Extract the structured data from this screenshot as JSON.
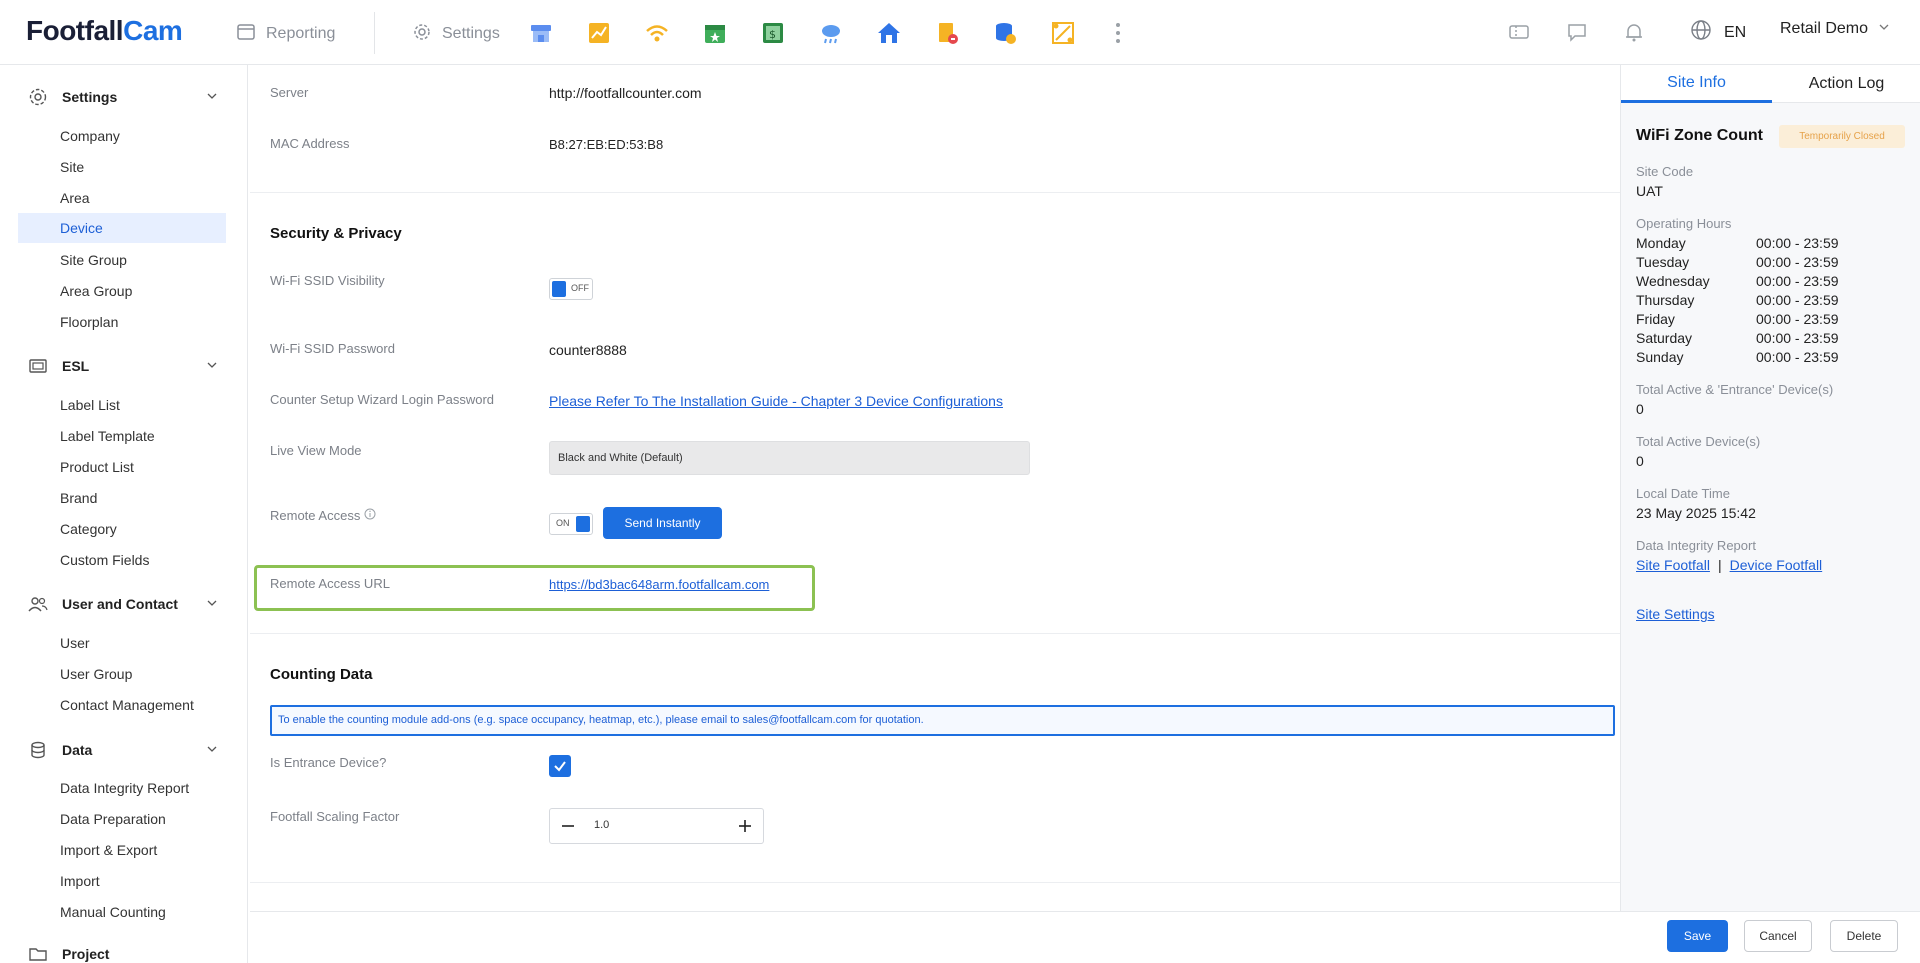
{
  "brand": {
    "part1": "Footfall",
    "part2": "Cam"
  },
  "nav": {
    "reporting": "Reporting",
    "settings": "Settings",
    "app_icons": [
      "shop-icon",
      "chart-icon",
      "wifi-icon",
      "calendar-icon",
      "spreadsheet-icon",
      "weather-icon",
      "home-icon",
      "document-icon",
      "database-icon",
      "diagram-icon"
    ],
    "language": "EN",
    "account": "Retail Demo"
  },
  "sidebar": {
    "settings": {
      "title": "Settings",
      "items": [
        "Company",
        "Site",
        "Area",
        "Device",
        "Site Group",
        "Area Group",
        "Floorplan"
      ],
      "active": "Device"
    },
    "esl": {
      "title": "ESL",
      "items": [
        "Label List",
        "Label Template",
        "Product List",
        "Brand",
        "Category",
        "Custom Fields"
      ]
    },
    "user": {
      "title": "User and Contact",
      "items": [
        "User",
        "User Group",
        "Contact Management"
      ]
    },
    "data": {
      "title": "Data",
      "items": [
        "Data Integrity Report",
        "Data Preparation",
        "Import & Export",
        "Import",
        "Manual Counting"
      ]
    },
    "project": {
      "title": "Project"
    }
  },
  "main": {
    "server": {
      "label": "Server",
      "value": "http://footfallcounter.com"
    },
    "mac": {
      "label": "MAC Address",
      "value": "B8:27:EB:ED:53:B8"
    },
    "security_title": "Security & Privacy",
    "ssid_visibility": {
      "label": "Wi-Fi SSID Visibility",
      "state": "OFF"
    },
    "ssid_password": {
      "label": "Wi-Fi SSID Password",
      "value": "counter8888"
    },
    "wizard_password": {
      "label": "Counter Setup Wizard Login Password",
      "link": "Please Refer To The Installation Guide - Chapter 3 Device Configurations"
    },
    "live_view": {
      "label": "Live View Mode",
      "value": "Black and White (Default)"
    },
    "remote_access": {
      "label": "Remote Access",
      "state": "ON",
      "button": "Send Instantly"
    },
    "remote_url": {
      "label": "Remote Access URL",
      "value": "https://bd3bac648arm.footfallcam.com"
    },
    "counting_title": "Counting Data",
    "notice": "To enable the counting module add-ons (e.g. space occupancy, heatmap, etc.), please email to sales@footfallcam.com for quotation.",
    "entrance": {
      "label": "Is Entrance Device?",
      "checked": true
    },
    "scaling": {
      "label": "Footfall Scaling Factor",
      "value": "1.0"
    }
  },
  "footer": {
    "save": "Save",
    "cancel": "Cancel",
    "delete": "Delete"
  },
  "right_panel": {
    "tabs": [
      "Site Info",
      "Action Log"
    ],
    "title": "WiFi Zone Count",
    "badge": "Temporarily Closed",
    "site_code_label": "Site Code",
    "site_code": "UAT",
    "hours_label": "Operating Hours",
    "hours": [
      {
        "day": "Monday",
        "time": "00:00 - 23:59"
      },
      {
        "day": "Tuesday",
        "time": "00:00 - 23:59"
      },
      {
        "day": "Wednesday",
        "time": "00:00 - 23:59"
      },
      {
        "day": "Thursday",
        "time": "00:00 - 23:59"
      },
      {
        "day": "Friday",
        "time": "00:00 - 23:59"
      },
      {
        "day": "Saturday",
        "time": "00:00 - 23:59"
      },
      {
        "day": "Sunday",
        "time": "00:00 - 23:59"
      }
    ],
    "total_entrance_label": "Total Active & 'Entrance' Device(s)",
    "total_entrance": "0",
    "total_active_label": "Total Active Device(s)",
    "total_active": "0",
    "local_time_label": "Local Date Time",
    "local_time": "23 May 2025 15:42",
    "integrity_label": "Data Integrity Report",
    "site_footfall": "Site Footfall",
    "separator": "|",
    "device_footfall": "Device Footfall",
    "site_settings": "Site Settings"
  },
  "colors": {
    "accent": "#1d6fe0",
    "highlight": "#8cc152",
    "badge_bg": "#fbeed8",
    "badge_text": "#e6a24a"
  }
}
